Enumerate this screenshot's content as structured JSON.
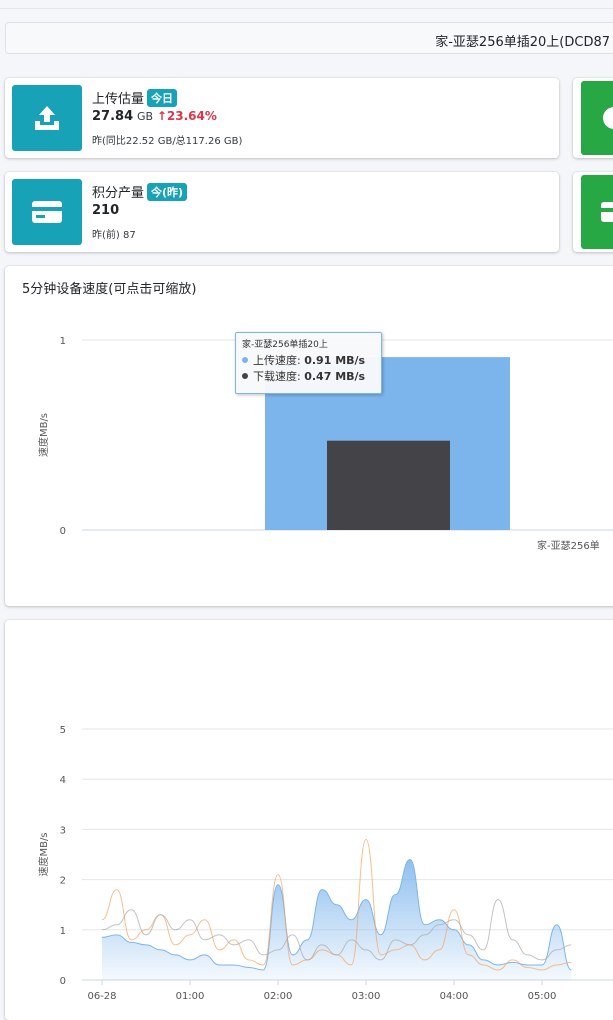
{
  "device_selector": {
    "value": "家-亚瑟256单插20上(DCD87"
  },
  "upload_card": {
    "label": "上传估量",
    "badge": "今日",
    "value": "27.84",
    "unit": "GB",
    "change": "23.64%",
    "sub": "昨(同比22.52 GB/总117.26 GB)",
    "icon": "upload-icon"
  },
  "points_card": {
    "label": "积分产量",
    "badge": "今(昨)",
    "value": "210",
    "sub": "昨(前) 87",
    "icon": "card-icon"
  },
  "colors": {
    "teal": "#17a2b8",
    "green": "#28a745",
    "upload": "#7cb5ec",
    "download": "#434348",
    "trend_up": "#dc3545"
  },
  "speed_chart": {
    "title": "5分钟设备速度(可点击可缩放)",
    "ylabel": "速度MB/s",
    "yticks": [
      "0",
      "1"
    ],
    "category_label": "家-亚瑟256单",
    "tooltip": {
      "title": "家-亚瑟256单插20上",
      "upload_label": "上传速度:",
      "upload_value": "0.91 MB/s",
      "download_label": "下载速度:",
      "download_value": "0.47 MB/s"
    }
  },
  "chart_data": [
    {
      "type": "bar",
      "title": "5分钟设备速度(可点击可缩放)",
      "ylabel": "速度MB/s",
      "categories": [
        "家-亚瑟256单插20上"
      ],
      "series": [
        {
          "name": "上传速度",
          "values": [
            0.91
          ]
        },
        {
          "name": "下载速度",
          "values": [
            0.47
          ]
        }
      ],
      "ylim": [
        0,
        1
      ],
      "grid": true
    },
    {
      "type": "area",
      "ylabel": "速度MB/s",
      "x": [
        "06-28",
        "",
        "",
        "",
        "",
        "",
        "01:00",
        "",
        "",
        "",
        "",
        "",
        "02:00",
        "",
        "",
        "",
        "",
        "",
        "03:00",
        "",
        "",
        "",
        "",
        "",
        "04:00",
        "",
        "",
        "",
        "",
        "",
        "05:00",
        "",
        ""
      ],
      "series": [
        {
          "values": [
            0.85,
            0.9,
            0.75,
            0.7,
            0.6,
            0.5,
            0.4,
            0.5,
            0.3,
            0.3,
            0.25,
            0.2,
            1.9,
            0.5,
            0.8,
            1.8,
            1.5,
            1.2,
            1.6,
            0.9,
            1.7,
            2.4,
            1.1,
            1.2,
            1.0,
            0.7,
            0.4,
            0.3,
            0.35,
            0.3,
            0.3,
            1.1,
            0.2
          ]
        },
        {
          "values": [
            1.2,
            1.8,
            0.8,
            1.0,
            1.3,
            0.7,
            0.9,
            1.2,
            0.6,
            0.8,
            0.4,
            0.3,
            2.1,
            0.3,
            0.4,
            0.6,
            0.5,
            0.3,
            2.8,
            0.5,
            0.6,
            0.7,
            0.4,
            0.6,
            1.4,
            0.5,
            0.3,
            0.2,
            0.4,
            0.25,
            0.2,
            0.3,
            0.35
          ]
        },
        {
          "values": [
            1.0,
            1.1,
            1.4,
            0.9,
            1.3,
            1.0,
            1.2,
            0.8,
            0.9,
            0.7,
            0.8,
            0.5,
            0.6,
            0.9,
            0.4,
            0.7,
            0.5,
            0.8,
            0.6,
            0.4,
            0.8,
            0.7,
            0.9,
            1.1,
            1.2,
            0.9,
            0.6,
            1.6,
            0.8,
            0.5,
            0.4,
            0.6,
            0.7
          ]
        }
      ],
      "ylim": [
        0,
        5
      ],
      "grid": true
    }
  ]
}
